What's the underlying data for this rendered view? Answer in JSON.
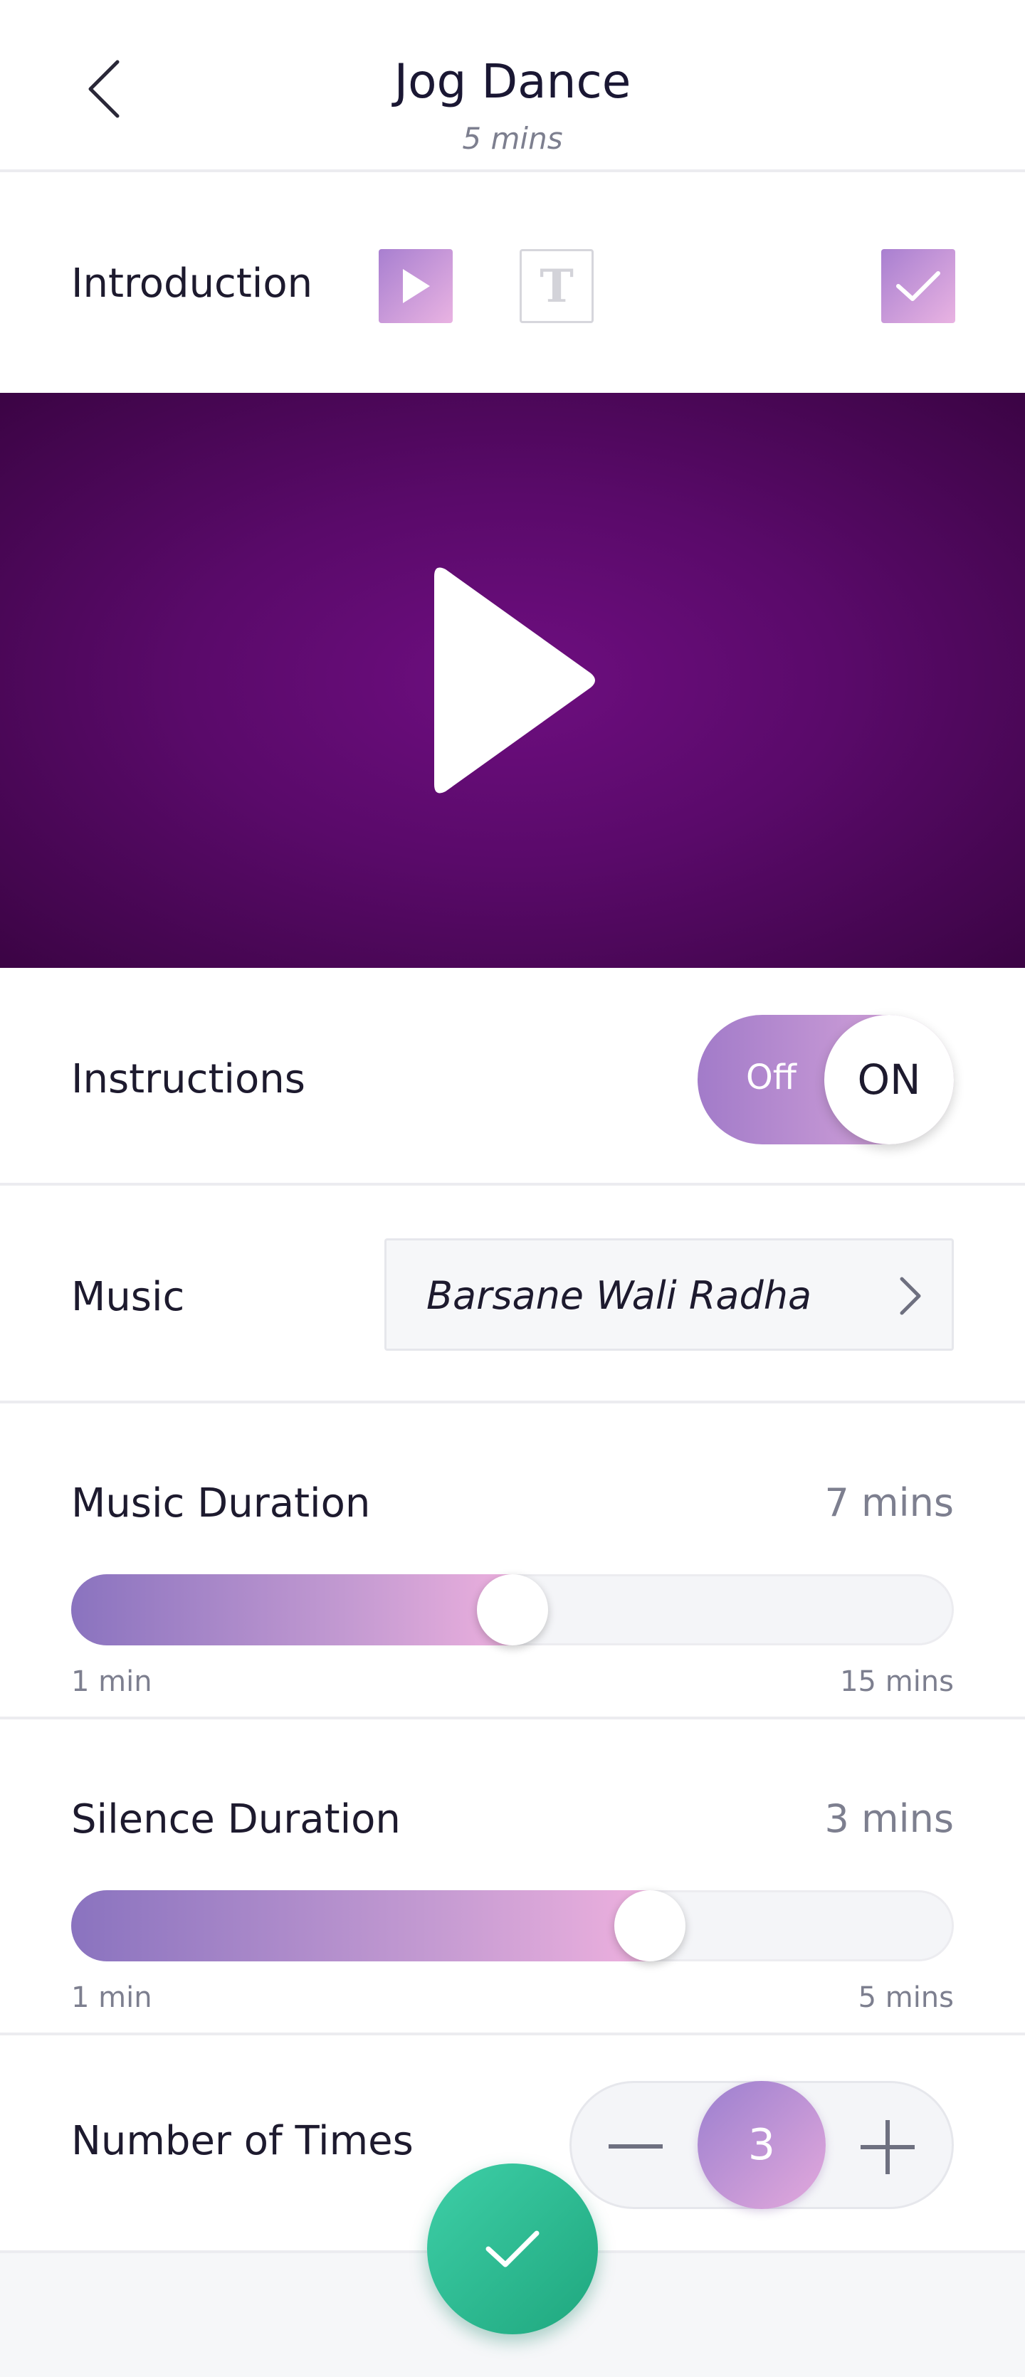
{
  "header": {
    "title": "Jog Dance",
    "subtitle": "5 mins"
  },
  "introduction": {
    "label": "Introduction",
    "text_glyph": "T"
  },
  "instructions": {
    "label": "Instructions",
    "toggle_off": "Off",
    "toggle_on": "ON"
  },
  "music": {
    "label": "Music",
    "value": "Barsane Wali Radha"
  },
  "music_duration": {
    "label": "Music Duration",
    "value": "7 mins",
    "min_label": "1 min",
    "max_label": "15 mins",
    "position": 0.5
  },
  "silence_duration": {
    "label": "Silence Duration",
    "value": "3 mins",
    "min_label": "1 min",
    "max_label": "5 mins",
    "position": 0.67
  },
  "times": {
    "label": "Number of Times",
    "value": "3"
  },
  "colors": {
    "accent_purple": "#a87fd0",
    "accent_pink": "#e9b3e2",
    "confirm_green": "#2bbc92",
    "video_purple": "#5a0a6a"
  }
}
